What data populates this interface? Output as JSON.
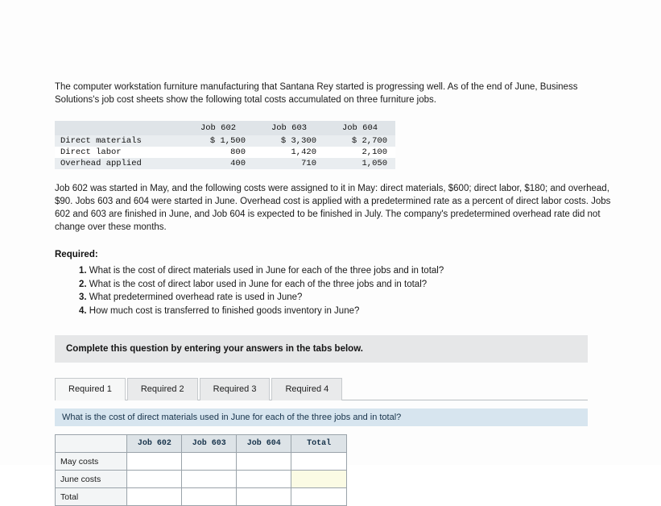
{
  "intro": "The computer workstation furniture manufacturing that Santana Rey started is progressing well. As of the end of June, Business Solutions's job cost sheets show the following total costs accumulated on three furniture jobs.",
  "cost_table": {
    "columns": [
      "",
      "Job 602",
      "Job 603",
      "Job 604"
    ],
    "rows": [
      {
        "label": "Direct materials",
        "values": [
          "$ 1,500",
          "$ 3,300",
          "$ 2,700"
        ]
      },
      {
        "label": "Direct labor",
        "values": [
          "800",
          "1,420",
          "2,100"
        ]
      },
      {
        "label": "Overhead applied",
        "values": [
          "400",
          "710",
          "1,050"
        ]
      }
    ]
  },
  "paragraph": "Job 602 was started in May, and the following costs were assigned to it in May: direct materials, $600; direct labor, $180; and overhead, $90. Jobs 603 and 604 were started in June. Overhead cost is applied with a predetermined rate as a percent of direct labor costs. Jobs 602 and 603 are finished in June, and Job 604 is expected to be finished in July. The company's predetermined overhead rate did not change over these months.",
  "required_title": "Required:",
  "requirements": [
    {
      "num": "1.",
      "text": "What is the cost of direct materials used in June for each of the three jobs and in total?"
    },
    {
      "num": "2.",
      "text": "What is the cost of direct labor used in June for each of the three jobs and in total?"
    },
    {
      "num": "3.",
      "text": "What predetermined overhead rate is used in June?"
    },
    {
      "num": "4.",
      "text": "How much cost is transferred to finished goods inventory in June?"
    }
  ],
  "widget": {
    "banner": "Complete this question by entering your answers in the tabs below.",
    "tabs": [
      {
        "label": "Required 1",
        "active": true
      },
      {
        "label": "Required 2",
        "active": false
      },
      {
        "label": "Required 3",
        "active": false
      },
      {
        "label": "Required 4",
        "active": false
      }
    ],
    "question": "What is the cost of direct materials used in June for each of the three jobs and in total?",
    "answer_table": {
      "columns": [
        "",
        "Job 602",
        "Job 603",
        "Job 604",
        "Total"
      ],
      "rows": [
        {
          "label": "May costs",
          "values": [
            "",
            "",
            "",
            ""
          ]
        },
        {
          "label": "June costs",
          "values": [
            "",
            "",
            "",
            ""
          ]
        },
        {
          "label": "Total",
          "values": [
            "",
            "",
            "",
            ""
          ]
        }
      ]
    }
  }
}
